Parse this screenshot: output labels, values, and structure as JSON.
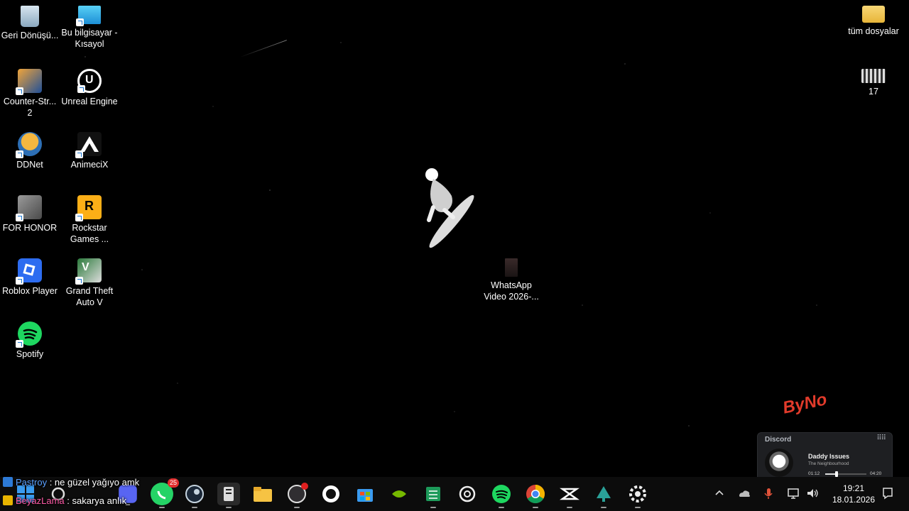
{
  "desktop_icons_left": [
    {
      "label": "Geri Dönüşü...",
      "icon": "recycle-bin-icon"
    },
    {
      "label": "Bu bilgisayar - Kısayol",
      "icon": "this-pc-icon"
    },
    {
      "label": "Counter-Str... 2",
      "icon": "counter-strike-icon"
    },
    {
      "label": "Unreal Engine",
      "icon": "unreal-engine-icon"
    },
    {
      "label": "DDNet",
      "icon": "ddnet-icon"
    },
    {
      "label": "AnimeciX",
      "icon": "animecix-icon"
    },
    {
      "label": "FOR HONOR",
      "icon": "for-honor-icon"
    },
    {
      "label": "Rockstar Games ...",
      "icon": "rockstar-games-icon"
    },
    {
      "label": "Roblox Player",
      "icon": "roblox-icon"
    },
    {
      "label": "Grand Theft Auto V",
      "icon": "gta-v-icon"
    },
    {
      "label": "Spotify",
      "icon": "spotify-icon"
    }
  ],
  "desktop_icons_right": [
    {
      "label": "tüm dosyalar",
      "icon": "folder-icon"
    },
    {
      "label": "17",
      "icon": "video-file-icon"
    }
  ],
  "desktop_file": {
    "label": "WhatsApp Video 2026-...",
    "icon": "video-thumbnail-icon"
  },
  "watermark_logo": "ByNo",
  "discord_widget": {
    "title": "Discord",
    "song": "Daddy Issues",
    "artist": "The Neighbourhood",
    "elapsed": "01:12",
    "duration": "04:20",
    "progress": 0.28
  },
  "chat_overlay": [
    {
      "user": "Pastroy",
      "separator": " : ",
      "message": "ne güzel yağıyo amk",
      "user_color": "#5aa0ff"
    },
    {
      "user": "BeyazLama",
      "separator": " : ",
      "message": "sakarya anlık",
      "user_color": "#ff5ca8"
    }
  ],
  "taskbar": {
    "apps": [
      {
        "name": "start-button",
        "icon": "windows-icon"
      },
      {
        "name": "search",
        "icon": "search-icon"
      },
      {
        "name": "discord",
        "icon": "discord-icon"
      },
      {
        "name": "whatsapp",
        "icon": "whatsapp-icon",
        "badge": "25"
      },
      {
        "name": "steam",
        "icon": "steam-icon"
      },
      {
        "name": "epic-launcher",
        "icon": "app-icon"
      },
      {
        "name": "file-explorer",
        "icon": "folder-icon"
      },
      {
        "name": "obs",
        "icon": "obs-icon"
      },
      {
        "name": "app-circle",
        "icon": "circle-app-icon"
      },
      {
        "name": "store",
        "icon": "store-icon"
      },
      {
        "name": "nvidia",
        "icon": "nvidia-icon"
      },
      {
        "name": "excel",
        "icon": "spreadsheet-icon"
      },
      {
        "name": "chatgpt",
        "icon": "chatgpt-icon"
      },
      {
        "name": "spotify",
        "icon": "spotify-icon"
      },
      {
        "name": "chrome",
        "icon": "chrome-icon"
      },
      {
        "name": "capcut",
        "icon": "capcut-icon"
      },
      {
        "name": "app-tree",
        "icon": "tree-app-icon"
      },
      {
        "name": "settings",
        "icon": "gear-icon"
      }
    ],
    "time": "19:21",
    "date": "18.01.2026"
  }
}
